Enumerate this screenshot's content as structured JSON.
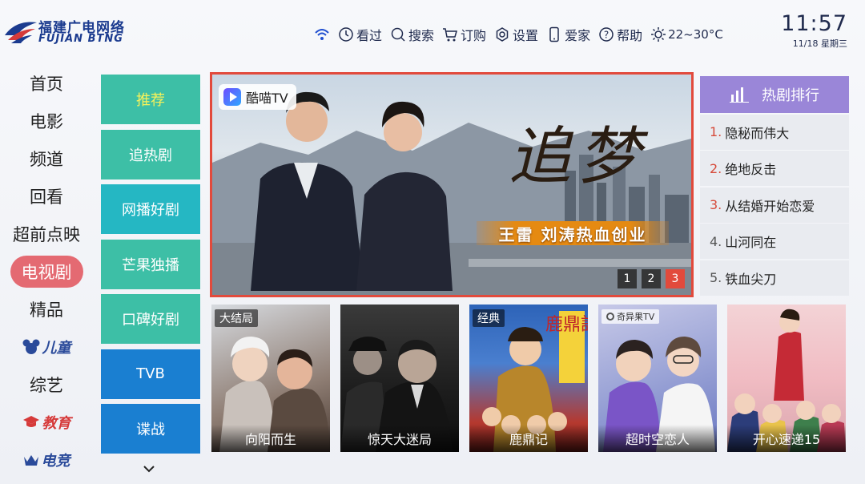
{
  "brand": {
    "name_cn": "福建广电网络",
    "name_en": "FUJIAN BTNG"
  },
  "topnav": [
    {
      "icon": "wifi-icon",
      "label": ""
    },
    {
      "icon": "clock-icon",
      "label": "看过"
    },
    {
      "icon": "search-icon",
      "label": "搜索"
    },
    {
      "icon": "cart-icon",
      "label": "订购"
    },
    {
      "icon": "gear-icon",
      "label": "设置"
    },
    {
      "icon": "phone-icon",
      "label": "爱家"
    },
    {
      "icon": "help-icon",
      "label": "帮助"
    }
  ],
  "weather": {
    "icon": "sun-icon",
    "text": "22~30°C"
  },
  "clock": {
    "time": "11:57",
    "date": "11/18  星期三"
  },
  "mainnav": [
    {
      "label": "首页",
      "active": false
    },
    {
      "label": "电影",
      "active": false
    },
    {
      "label": "频道",
      "active": false
    },
    {
      "label": "回看",
      "active": false
    },
    {
      "label": "超前点映",
      "active": false
    },
    {
      "label": "电视剧",
      "active": true
    },
    {
      "label": "精品",
      "active": false
    },
    {
      "label": "儿童",
      "active": false,
      "icon": "mickey-icon",
      "color": "#2a4a9a"
    },
    {
      "label": "综艺",
      "active": false
    },
    {
      "label": "教育",
      "active": false,
      "icon": "graduation-cap-icon",
      "color": "#d63a3a"
    },
    {
      "label": "电竞",
      "active": false,
      "icon": "crown-icon",
      "color": "#2a4a9a"
    }
  ],
  "subnav": [
    {
      "label": "推荐",
      "style": "green",
      "selected": true
    },
    {
      "label": "追热剧",
      "style": "green"
    },
    {
      "label": "网播好剧",
      "style": "teal"
    },
    {
      "label": "芒果独播",
      "style": "green"
    },
    {
      "label": "口碑好剧",
      "style": "green"
    },
    {
      "label": "TVB",
      "style": "blue"
    },
    {
      "label": "谍战",
      "style": "blue"
    }
  ],
  "banner": {
    "platform": "酷喵TV",
    "title": "追梦",
    "tagline": "王雷 刘涛热血创业",
    "pages": [
      "1",
      "2",
      "3"
    ],
    "active_page": "3"
  },
  "ranking": {
    "title": "热剧排行",
    "items": [
      {
        "num": "1.",
        "title": "隐秘而伟大",
        "hot": true
      },
      {
        "num": "2.",
        "title": "绝地反击",
        "hot": true
      },
      {
        "num": "3.",
        "title": "从结婚开始恋爱",
        "hot": true
      },
      {
        "num": "4.",
        "title": "山河同在",
        "hot": false
      },
      {
        "num": "5.",
        "title": "铁血尖刀",
        "hot": false
      }
    ]
  },
  "posters": [
    {
      "title": "向阳而生",
      "tag": "大结局"
    },
    {
      "title": "惊天大迷局",
      "tag": ""
    },
    {
      "title": "鹿鼎记",
      "tag": "经典",
      "art_text": "鹿鼎記"
    },
    {
      "title": "超时空恋人",
      "tag": "奇异果TV"
    },
    {
      "title": "开心速递15",
      "tag": ""
    }
  ],
  "colors": {
    "accent_red": "#e46a72",
    "sub_green": "#3dbfa6",
    "sub_teal": "#25b7c3",
    "sub_blue": "#1a7fd1",
    "rank_head": "#9a86d8",
    "banner_border": "#e24a3c"
  }
}
